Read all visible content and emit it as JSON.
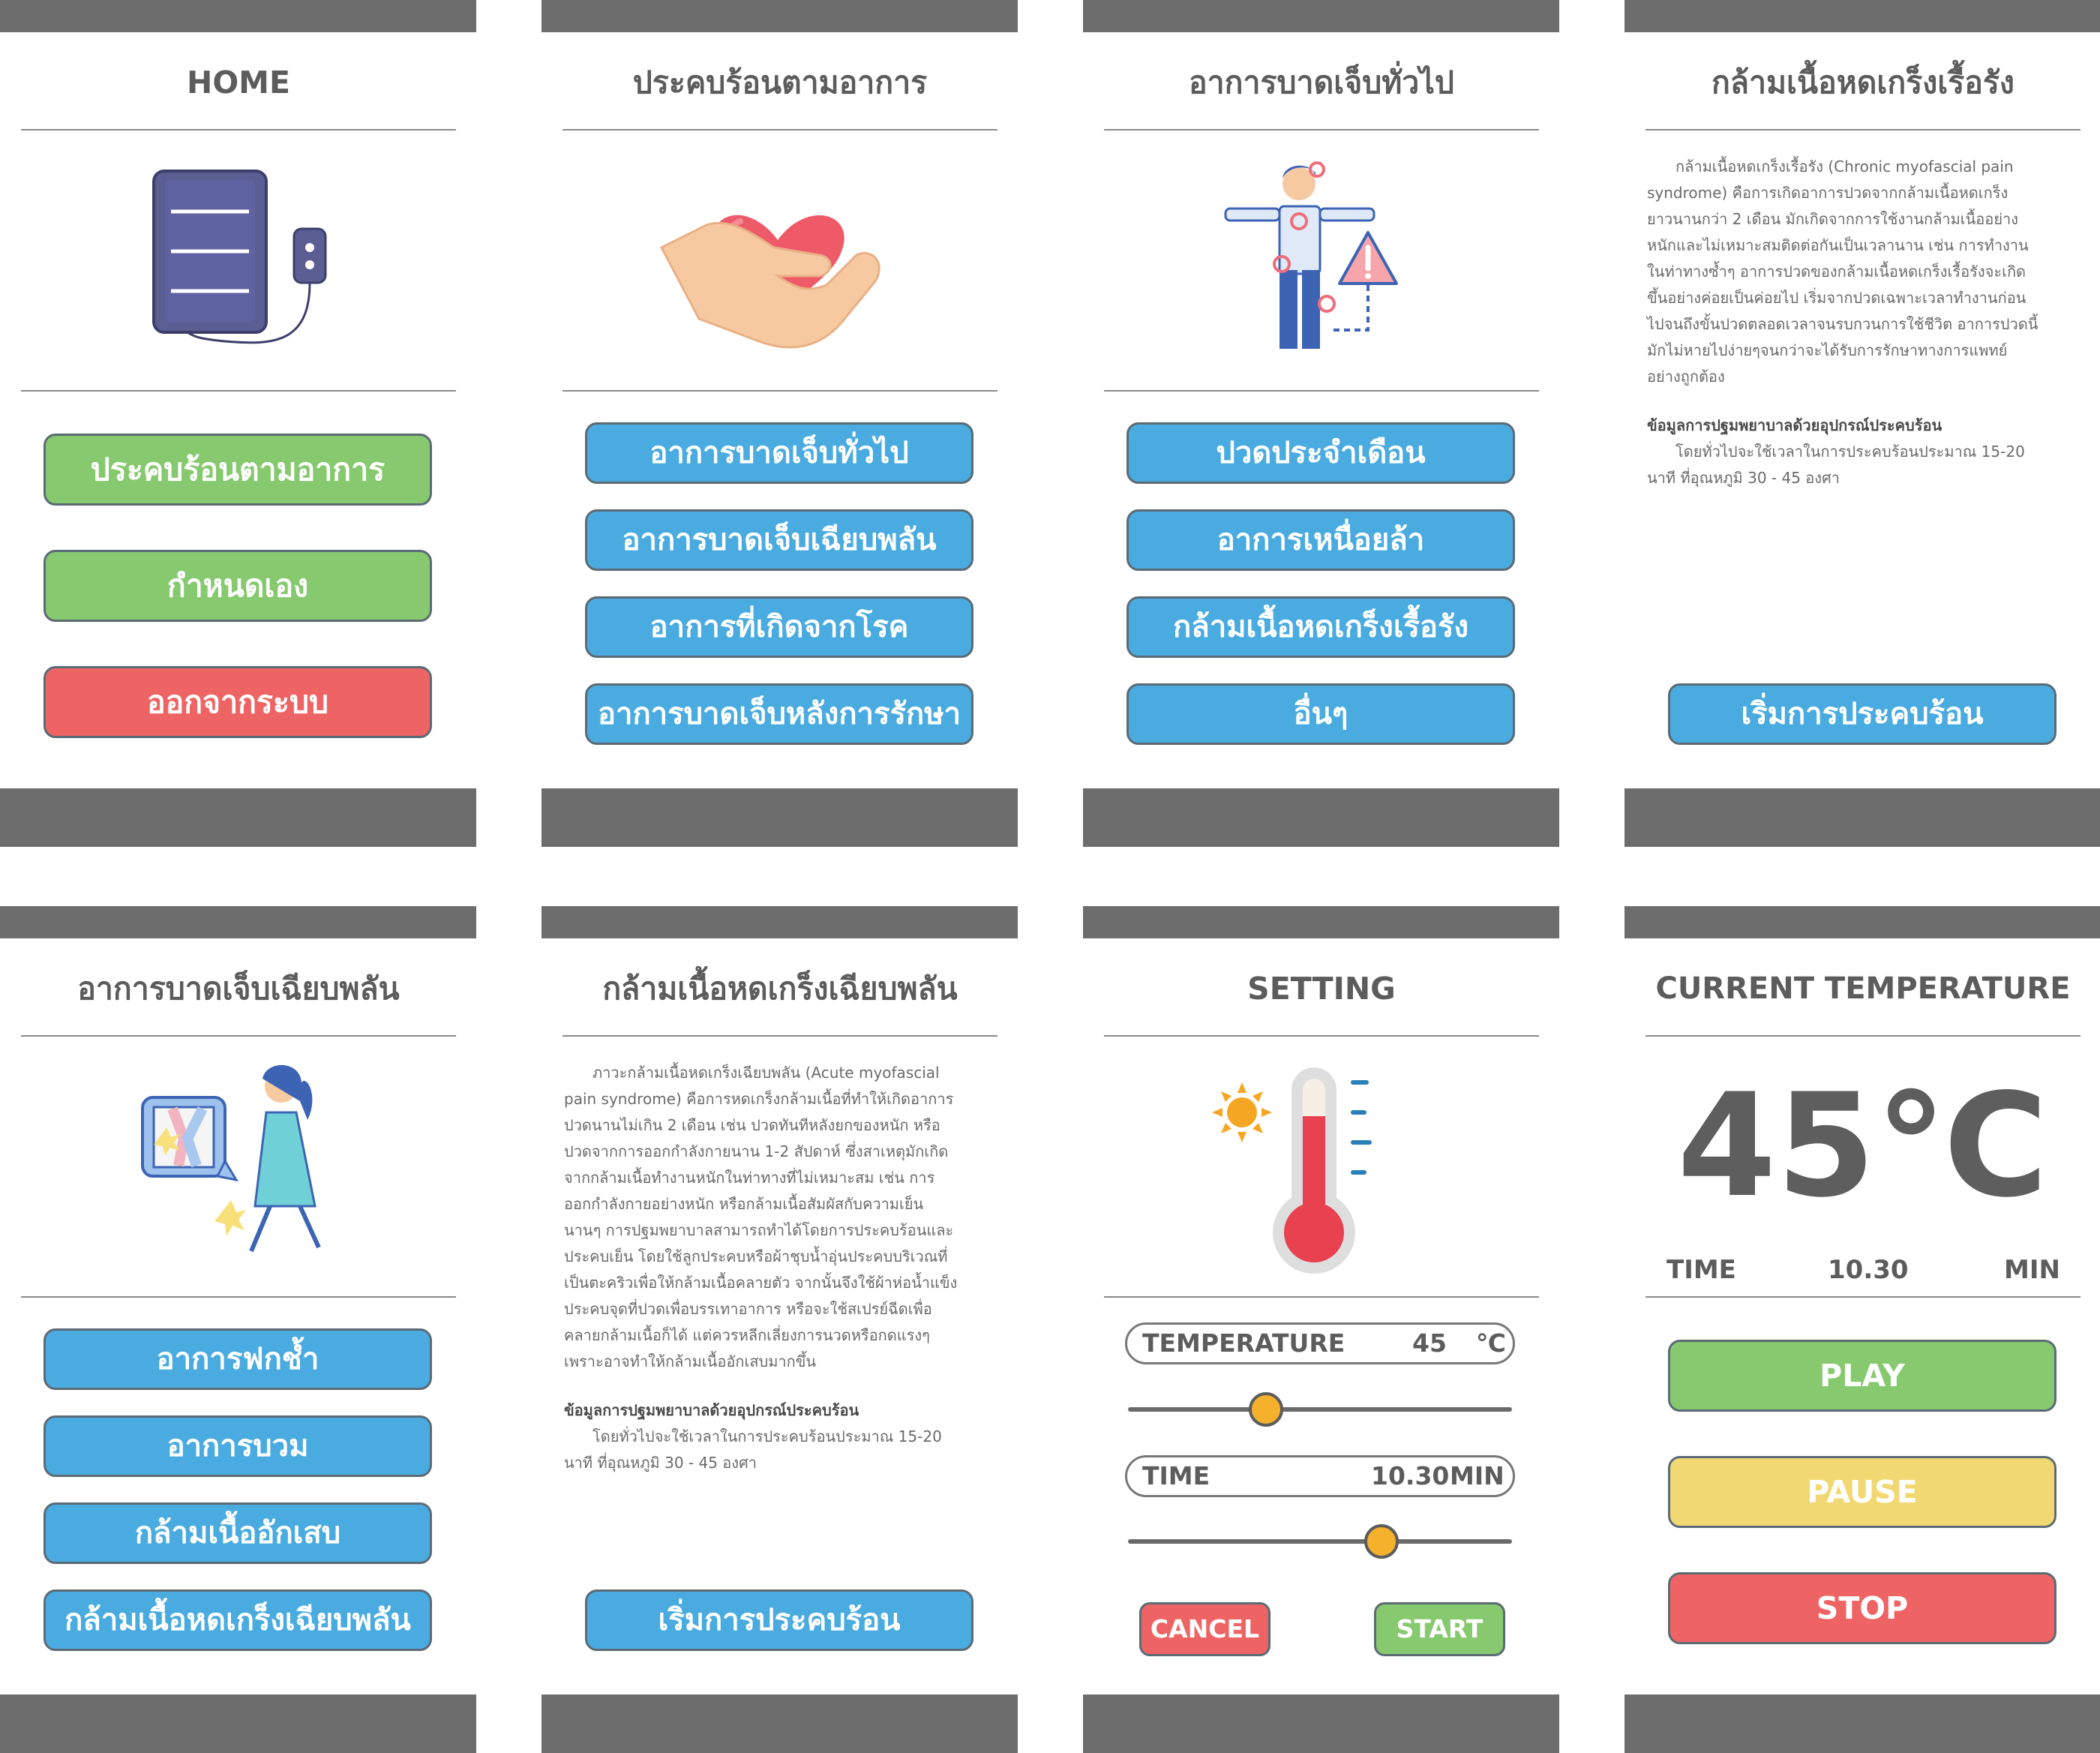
{
  "home": {
    "title": "HOME",
    "buttons": [
      "ประคบร้อนตามอาการ",
      "กำหนดเอง",
      "ออกจากระบบ"
    ]
  },
  "symptom_menu": {
    "title": "ประคบร้อนตามอาการ",
    "buttons": [
      "อาการบาดเจ็บทั่วไป",
      "อาการบาดเจ็บเฉียบพลัน",
      "อาการที่เกิดจากโรค",
      "อาการบาดเจ็บหลังการรักษา"
    ]
  },
  "general_injury": {
    "title": "อาการบาดเจ็บทั่วไป",
    "buttons": [
      "ปวดประจำเดือน",
      "อาการเหนื่อยล้า",
      "กล้ามเนื้อหดเกร็งเรื้อรัง",
      "อื่นๆ"
    ]
  },
  "chronic_detail": {
    "title": "กล้ามเนื้อหดเกร็งเรื้อรัง",
    "body": "กล้ามเนื้อหดเกร็งเรื้อรัง (Chronic myofascial pain syndrome) คือการเกิดอาการปวดจากกล้ามเนื้อหดเกร็งยาวนานกว่า 2 เดือน มักเกิดจากการใช้งานกล้ามเนื้ออย่างหนักและไม่เหมาะสมติดต่อกันเป็นเวลานาน เช่น การทำงานในท่าทางซ้ำๆ อาการปวดของกล้ามเนื้อหดเกร็งเรื้อรังจะเกิดขึ้นอย่างค่อยเป็นค่อยไป เริ่มจากปวดเฉพาะเวลาทำงานก่อน ไปจนถึงขั้นปวดตลอดเวลาจนรบกวนการใช้ชีวิต อาการปวดนี้มักไม่หายไปง่ายๆจนกว่าจะได้รับการรักษาทางการแพทย์อย่างถูกต้อง",
    "info_heading": "ข้อมูลการปฐมพยาบาลด้วยอุปกรณ์ประคบร้อน",
    "info_body": "โดยทั่วไปจะใช้เวลาในการประคบร้อนประมาณ 15-20 นาที ที่อุณหภูมิ 30 - 45 องศา",
    "start_button": "เริ่มการประคบร้อน"
  },
  "acute_injury": {
    "title": "อาการบาดเจ็บเฉียบพลัน",
    "buttons": [
      "อาการฟกช้ำ",
      "อาการบวม",
      "กล้ามเนื้ออักเสบ",
      "กล้ามเนื้อหดเกร็งเฉียบพลัน"
    ]
  },
  "acute_detail": {
    "title": "กล้ามเนื้อหดเกร็งเฉียบพลัน",
    "body": "ภาวะกล้ามเนื้อหดเกร็งเฉียบพลัน (Acute myofascial pain syndrome) คือการหดเกร็งกล้ามเนื้อที่ทำให้เกิดอาการปวดนานไม่เกิน 2 เดือน เช่น ปวดทันทีหลังยกของหนัก หรือปวดจากการออกกำลังกายนาน 1-2 สัปดาห์ ซึ่งสาเหตุมักเกิดจากกล้ามเนื้อทำงานหนักในท่าทางที่ไม่เหมาะสม เช่น การออกกำลังกายอย่างหนัก หรือกล้ามเนื้อสัมผัสกับความเย็นนานๆ การปฐมพยาบาลสามารถทำได้โดยการประคบร้อนและประคบเย็น โดยใช้ลูกประคบหรือผ้าชุบน้ำอุ่นประคบบริเวณที่เป็นตะคริวเพื่อให้กล้ามเนื้อคลายตัว จากนั้นจึงใช้ผ้าห่อน้ำแข็งประคบจุดที่ปวดเพื่อบรรเทาอาการ หรือจะใช้สเปรย์ฉีดเพื่อคลายกล้ามเนื้อก็ได้ แต่ควรหลีกเลี่ยงการนวดหรือกดแรงๆ เพราะอาจทำให้กล้ามเนื้ออักเสบมากขึ้น",
    "info_heading": "ข้อมูลการปฐมพยาบาลด้วยอุปกรณ์ประคบร้อน",
    "info_body": "โดยทั่วไปจะใช้เวลาในการประคบร้อนประมาณ 15-20 นาที ที่อุณหภูมิ 30 - 45 องศา",
    "start_button": "เริ่มการประคบร้อน"
  },
  "setting": {
    "title": "SETTING",
    "temperature_label": "TEMPERATURE",
    "temperature_value": "45",
    "temperature_unit": "℃",
    "temperature_slider_fraction": 0.36,
    "time_label": "TIME",
    "time_value": "10.30",
    "time_unit": "MIN",
    "time_slider_fraction": 0.66,
    "cancel_button": "CANCEL",
    "start_button": "START"
  },
  "current": {
    "title": "CURRENT TEMPERATURE",
    "temperature": "45℃",
    "time_label": "TIME",
    "time_value": "10.30",
    "time_unit": "MIN",
    "play_button": "PLAY",
    "pause_button": "PAUSE",
    "stop_button": "STOP"
  },
  "colors": {
    "bar": "#6d6d6d",
    "green": "#86c96f",
    "red": "#ee6464",
    "blue": "#4aabe0",
    "yellow": "#f1d873",
    "knob": "#f5b12c"
  }
}
